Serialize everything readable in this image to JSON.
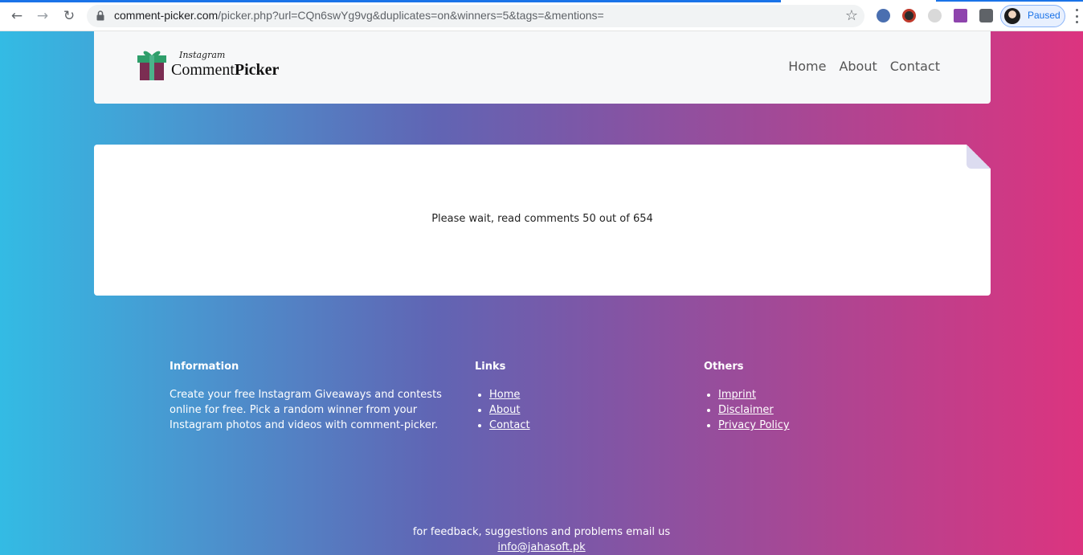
{
  "browser": {
    "url_host": "comment-picker.com",
    "url_path": "/picker.php?url=CQn6swYg9vg&duplicates=on&winners=5&tags=&mentions=",
    "profile_status": "Paused"
  },
  "header": {
    "logo_script": "Instagram",
    "logo_word_a": "Comment",
    "logo_word_b": "Picker",
    "nav": [
      "Home",
      "About",
      "Contact"
    ]
  },
  "card": {
    "status_text": "Please wait, read comments 50 out of 654"
  },
  "footer": {
    "info_title": "Information",
    "info_text": "Create your free Instagram Giveaways and contests online for free. Pick a random winner from your Instagram photos and videos with comment-picker.",
    "links_title": "Links",
    "links": [
      "Home",
      "About",
      "Contact"
    ],
    "others_title": "Others",
    "others": [
      "Imprint",
      "Disclaimer",
      "Privacy Policy"
    ],
    "feedback_text": "for feedback, suggestions and problems email us",
    "email": "info@jahasoft.pk"
  }
}
